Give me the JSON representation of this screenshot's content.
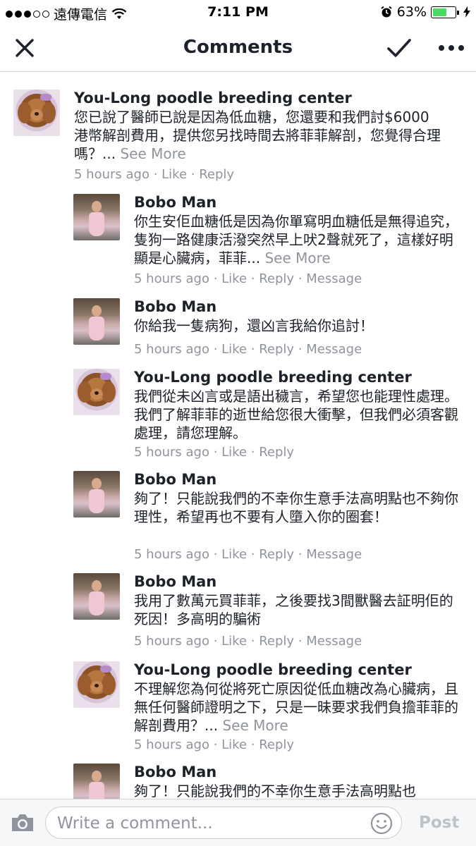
{
  "status": {
    "carrier": "遠傳電信",
    "time": "7:11 PM",
    "battery": "63%",
    "battery_level": 0.63
  },
  "nav": {
    "title": "Comments"
  },
  "comments": [
    {
      "author": "You-Long poodle breeding center",
      "text": "您已說了醫師已說是因為低血糖，您還要和我們討$6000港幣解剖費用，提供您另找時間去將菲菲解剖，您覺得合理嗎？...",
      "see_more": "See More",
      "time": "5 hours ago",
      "like": "Like",
      "reply": "Reply"
    },
    {
      "author": "Bobo Man",
      "text": "你生安佢血糖低是因為你單寫明血糖低是無得追究，隻狗一路健康活潑突然早上吠2聲就死了，這樣好明顯是心臟病，菲菲...",
      "see_more": "See More",
      "time": "5 hours ago",
      "like": "Like",
      "reply": "Reply",
      "message": "Message"
    },
    {
      "author": "Bobo Man",
      "text": "你給我一隻病狗，還凶言我給你追討！",
      "time": "5 hours ago",
      "like": "Like",
      "reply": "Reply",
      "message": "Message"
    },
    {
      "author": "You-Long poodle breeding center",
      "text": "我們從未凶言或是語出穢言，希望您也能理性處理。我們了解菲菲的逝世給您很大衝擊，但我們必須客觀處理，請您理解。",
      "time": "5 hours ago",
      "like": "Like",
      "reply": "Reply"
    },
    {
      "author": "Bobo Man",
      "text": "夠了！只能說我們的不幸你生意手法高明點也不夠你理性，希望再也不要有人墮入你的圈套！",
      "time": "5 hours ago",
      "like": "Like",
      "reply": "Reply",
      "message": "Message"
    },
    {
      "author": "Bobo Man",
      "text": "我用了數萬元買菲菲，之後要找3間獸醫去証明佢的死因！多高明的騙術",
      "time": "5 hours ago",
      "like": "Like",
      "reply": "Reply",
      "message": "Message"
    },
    {
      "author": "You-Long poodle breeding center",
      "text": "不理解您為何從將死亡原因從低血糖改為心臟病，且無任何醫師證明之下，只是一昧要求我們負擔菲菲的解剖費用？...",
      "see_more": "See More",
      "time": "5 hours ago",
      "like": "Like",
      "reply": "Reply"
    },
    {
      "author": "Bobo Man",
      "text": "夠了！只能說我們的不幸你生意手法高明點也"
    }
  ],
  "composer": {
    "placeholder": "Write a comment...",
    "post_label": "Post"
  },
  "icons": {
    "close": "close-icon",
    "check": "checkmark-icon",
    "more": "more-icon",
    "camera": "camera-icon",
    "emoji": "emoji-icon"
  },
  "colors": {
    "text": "#1d2129",
    "meta": "#90949c",
    "battery": "#4cd964",
    "post_disabled": "#bec2c9"
  }
}
